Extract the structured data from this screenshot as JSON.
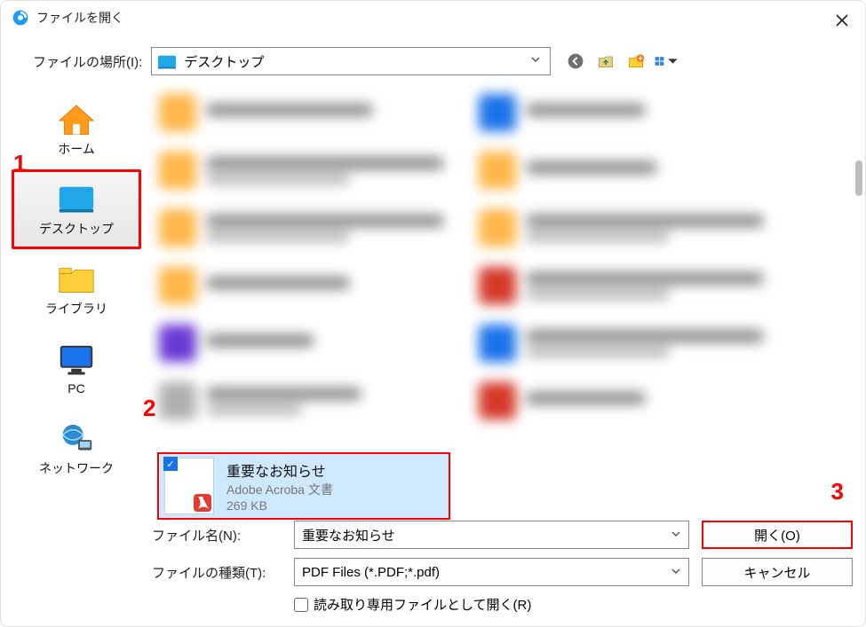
{
  "window": {
    "title": "ファイルを開く"
  },
  "toolbar": {
    "location_label": "ファイルの場所(I):",
    "location_value": "デスクトップ"
  },
  "places": {
    "home": "ホーム",
    "desktop": "デスクトップ",
    "library": "ライブラリ",
    "pc": "PC",
    "network": "ネットワーク"
  },
  "selected_file": {
    "name": "重要なお知らせ",
    "type": "Adobe Acroba 文書",
    "size": "269 KB"
  },
  "bottom": {
    "filename_label": "ファイル名(N):",
    "filename_value": "重要なお知らせ",
    "filetype_label": "ファイルの種類(T):",
    "filetype_value": "PDF Files (*.PDF;*.pdf)",
    "open_button": "開く(O)",
    "cancel_button": "キャンセル",
    "readonly_label": "読み取り専用ファイルとして開く(R)"
  },
  "annotations": {
    "a1": "1",
    "a2": "2",
    "a3": "3"
  }
}
